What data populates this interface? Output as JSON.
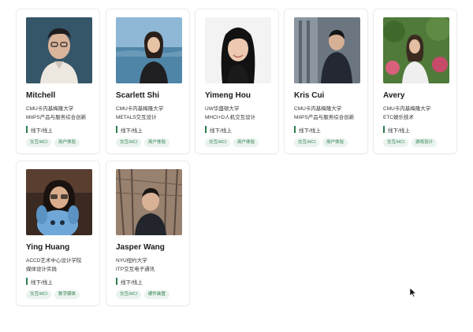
{
  "mentors": [
    {
      "name": "Mitchell",
      "school": "CMU卡内基梅隆大学",
      "program": "MIIPS产品与服务综合创新",
      "mode": "线下/线上",
      "tags": [
        "交互/HCI",
        "用户体验"
      ],
      "photo": "portrait-man-glasses"
    },
    {
      "name": "Scarlett Shi",
      "school": "CMU卡内基梅隆大学",
      "program": "METALS交互设计",
      "mode": "线下/线上",
      "tags": [
        "交互/HCI",
        "用户体验"
      ],
      "photo": "portrait-woman-seaside"
    },
    {
      "name": "Yimeng Hou",
      "school": "UW华盛顿大学",
      "program": "MHCI+D人机交互设计",
      "mode": "线下/线上",
      "tags": [
        "交互/HCI",
        "用户体验"
      ],
      "photo": "portrait-woman-white-bg"
    },
    {
      "name": "Kris Cui",
      "school": "CMU卡内基梅隆大学",
      "program": "MIIPS产品与服务综合创新",
      "mode": "线下/线上",
      "tags": [
        "交互/HCI",
        "用户体验"
      ],
      "photo": "portrait-man-street"
    },
    {
      "name": "Avery",
      "school": "CMU卡内基梅隆大学",
      "program": "ETC娱乐技术",
      "mode": "线下/线上",
      "tags": [
        "交互/HCI",
        "游戏设计"
      ],
      "photo": "portrait-woman-garden"
    },
    {
      "name": "Ying Huang",
      "school": "ACCD艺术中心设计学院",
      "program": "媒体设计实践",
      "mode": "线下/线上",
      "tags": [
        "交互/HCI",
        "数字媒体"
      ],
      "photo": "portrait-woman-plush-toy"
    },
    {
      "name": "Jasper Wang",
      "school": "NYU纽约大学",
      "program": "ITP交互电子通讯",
      "mode": "线下/线上",
      "tags": [
        "交互/HCI",
        "硬件装置"
      ],
      "photo": "portrait-man-bridge"
    }
  ]
}
